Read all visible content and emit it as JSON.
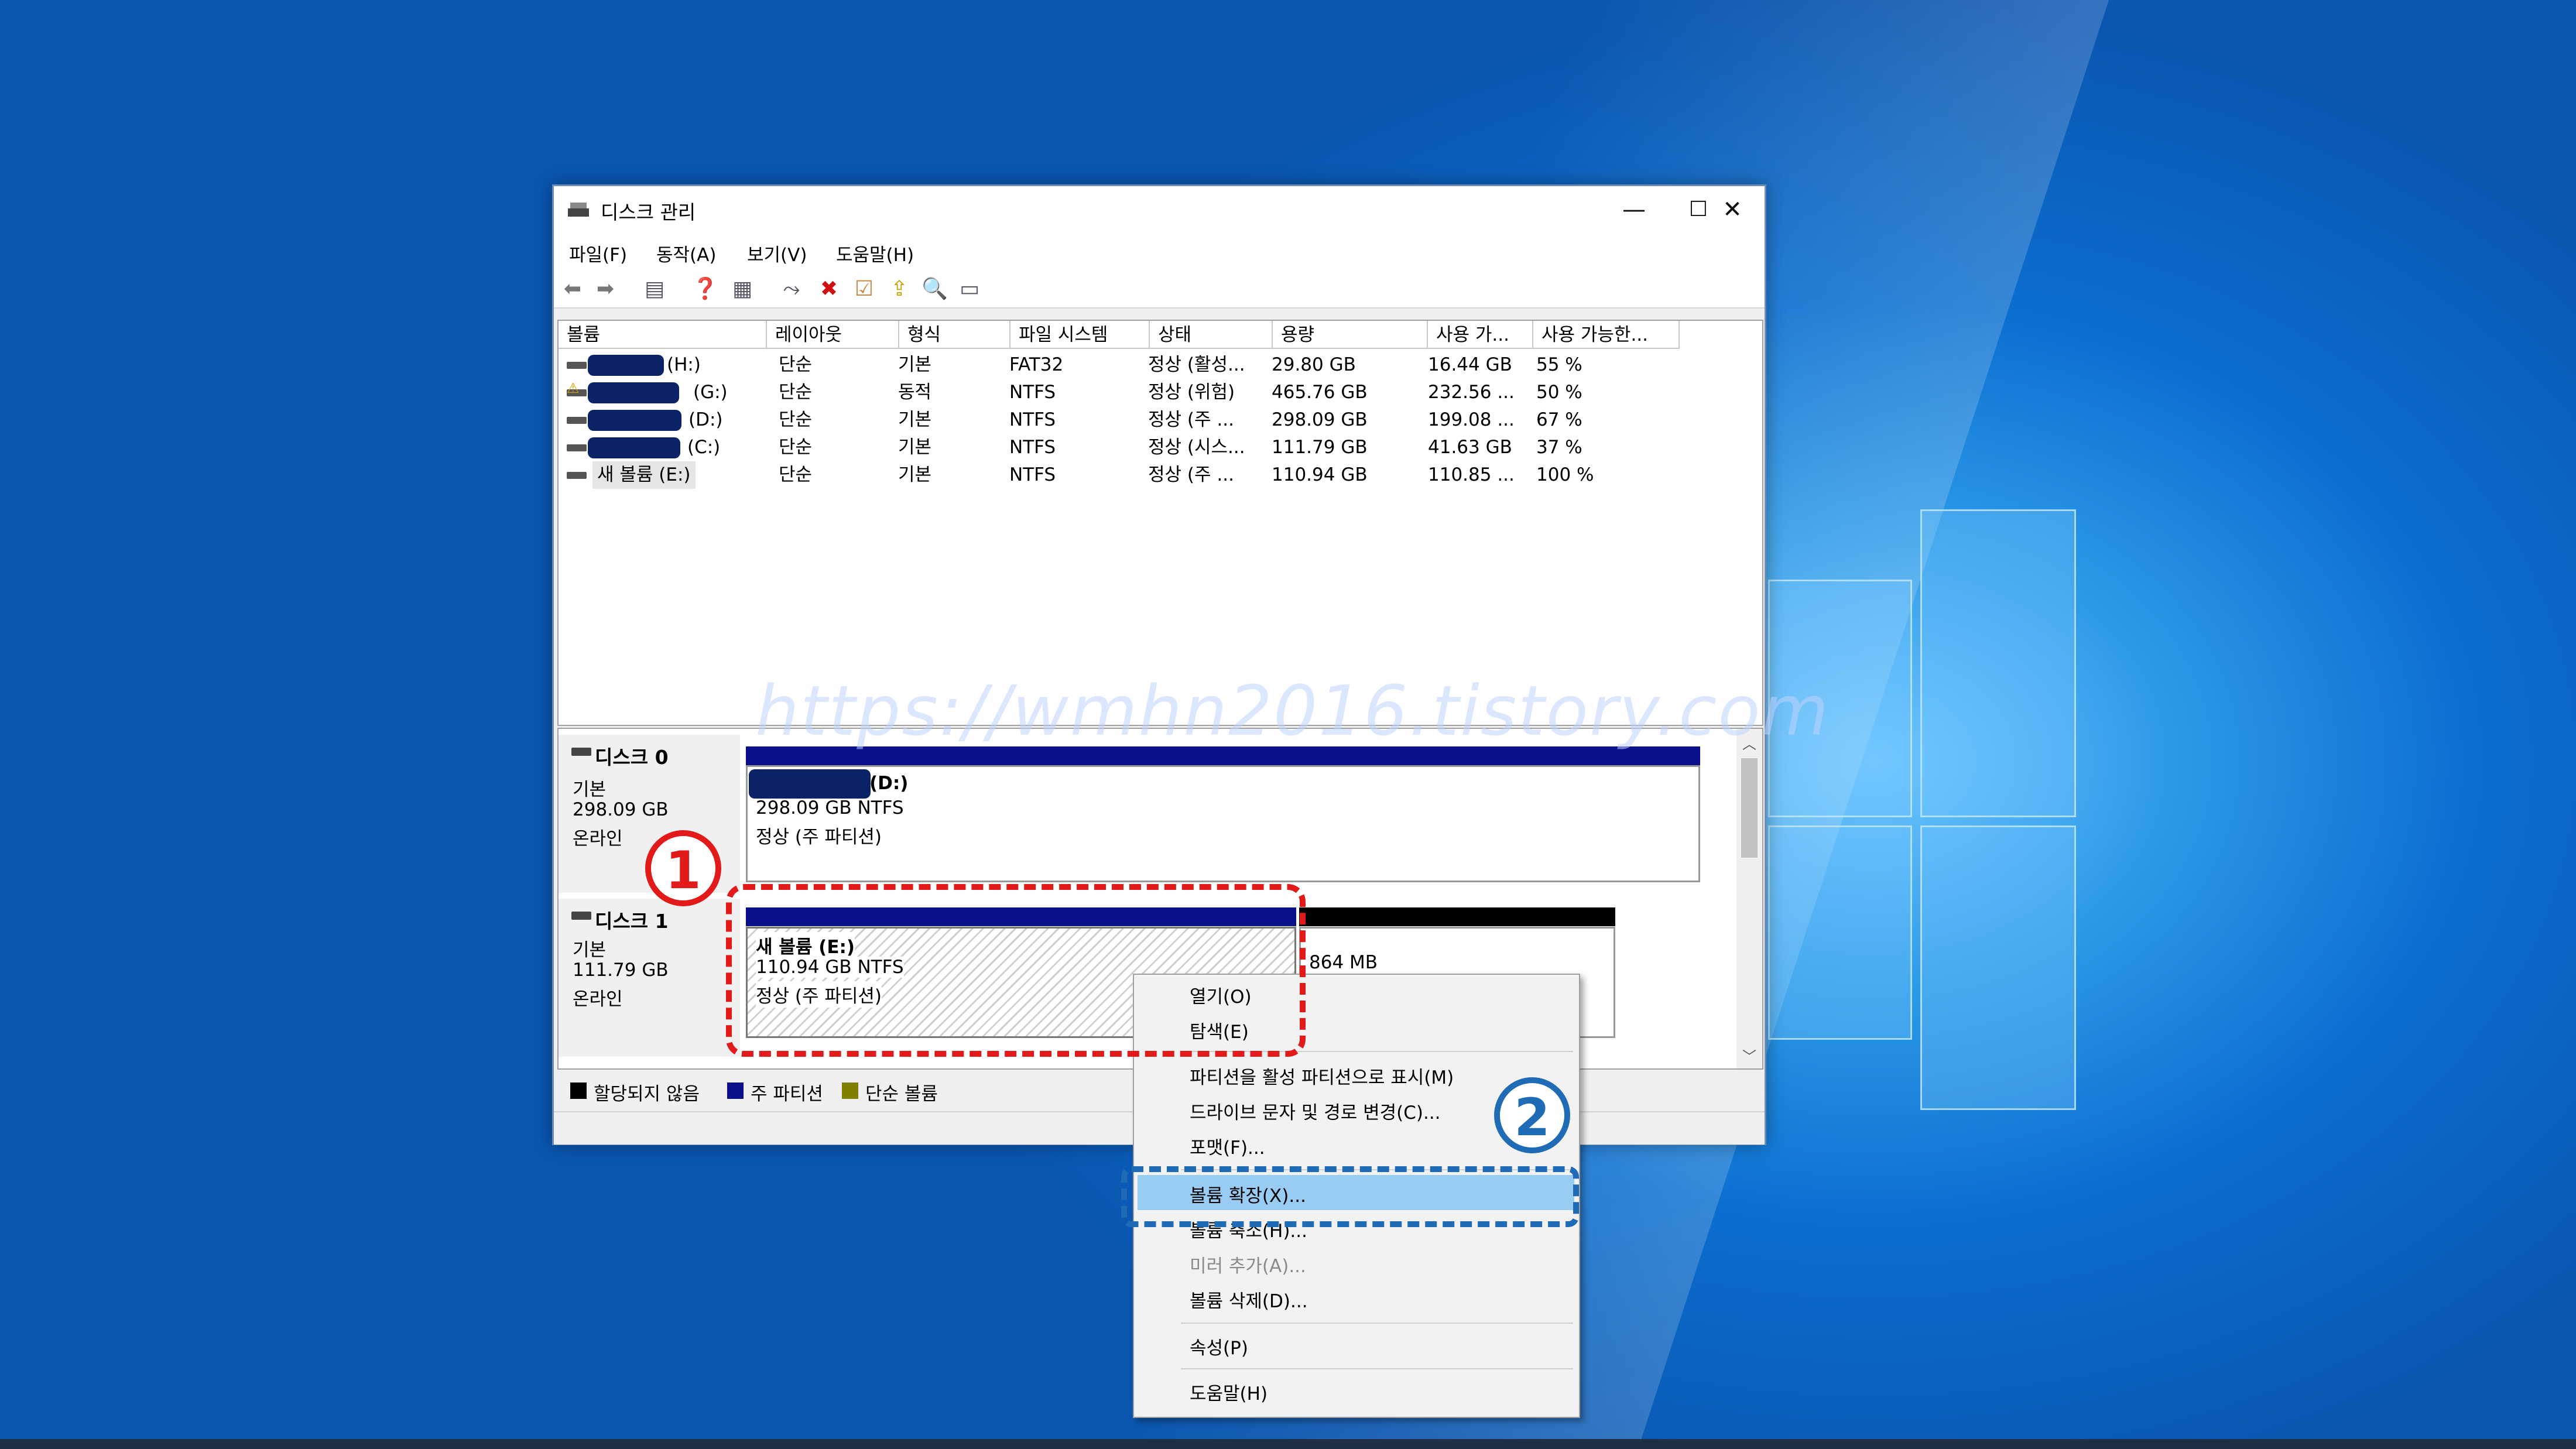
{
  "window": {
    "title": "디스크 관리",
    "minimize": "—",
    "maximize": "☐",
    "close": "✕"
  },
  "menu": [
    "파일(F)",
    "동작(A)",
    "보기(V)",
    "도움말(H)"
  ],
  "columns": [
    "볼륨",
    "레이아웃",
    "형식",
    "파일 시스템",
    "상태",
    "용량",
    "사용 가...",
    "사용 가능한..."
  ],
  "volumes": [
    {
      "name": "(H:)",
      "layout": "단순",
      "type": "기본",
      "fs": "FAT32",
      "status": "정상 (활성...",
      "capacity": "29.80 GB",
      "free": "16.44 GB",
      "pct": "55 %"
    },
    {
      "name": "(G:)",
      "layout": "단순",
      "type": "동적",
      "fs": "NTFS",
      "status": "정상 (위험)",
      "capacity": "465.76 GB",
      "free": "232.56 ...",
      "pct": "50 %"
    },
    {
      "name": "(D:)",
      "layout": "단순",
      "type": "기본",
      "fs": "NTFS",
      "status": "정상 (주 ...",
      "capacity": "298.09 GB",
      "free": "199.08 ...",
      "pct": "67 %"
    },
    {
      "name": "(C:)",
      "layout": "단순",
      "type": "기본",
      "fs": "NTFS",
      "status": "정상 (시스...",
      "capacity": "111.79 GB",
      "free": "41.63 GB",
      "pct": "37 %"
    },
    {
      "name": "새 볼륨 (E:)",
      "layout": "단순",
      "type": "기본",
      "fs": "NTFS",
      "status": "정상 (주 ...",
      "capacity": "110.94 GB",
      "free": "110.85 ...",
      "pct": "100 %"
    }
  ],
  "watermark": "https://wmhn2016.tistory.com",
  "disks": [
    {
      "name": "디스크 0",
      "kind": "기본",
      "size": "298.09 GB",
      "state": "온라인",
      "partition": {
        "label": "(D:)",
        "size": "298.09 GB NTFS",
        "status": "정상 (주 파티션)"
      }
    },
    {
      "name": "디스크 1",
      "kind": "기본",
      "size": "111.79 GB",
      "state": "온라인",
      "partition": {
        "label": "새 볼륨  (E:)",
        "size": "110.94 GB NTFS",
        "status": "정상 (주 파티션)"
      },
      "unallocated": "864 MB"
    }
  ],
  "legend": [
    "할당되지 않음",
    "주 파티션",
    "단순 볼륨"
  ],
  "context_menu": [
    {
      "label": "열기(O)",
      "enabled": true
    },
    {
      "label": "탐색(E)",
      "enabled": true
    },
    {
      "label": "파티션을 활성 파티션으로 표시(M)",
      "enabled": true
    },
    {
      "label": "드라이브 문자 및 경로 변경(C)...",
      "enabled": true
    },
    {
      "label": "포맷(F)...",
      "enabled": true
    },
    {
      "label": "볼륨 확장(X)...",
      "enabled": true,
      "highlighted": true
    },
    {
      "label": "볼륨 축소(H)...",
      "enabled": true
    },
    {
      "label": "미러 추가(A)...",
      "enabled": false
    },
    {
      "label": "볼륨 삭제(D)...",
      "enabled": true
    },
    {
      "label": "속성(P)",
      "enabled": true
    },
    {
      "label": "도움말(H)",
      "enabled": true
    }
  ],
  "annotations": {
    "step1": "1",
    "step2": "2"
  },
  "colors": {
    "primary_partition": "#0a0f8a",
    "unallocated": "#000000",
    "simple_volume": "#808000",
    "highlight": "#99ccf3",
    "annotation_red": "#e21a1a",
    "annotation_blue": "#1f6bb5"
  }
}
